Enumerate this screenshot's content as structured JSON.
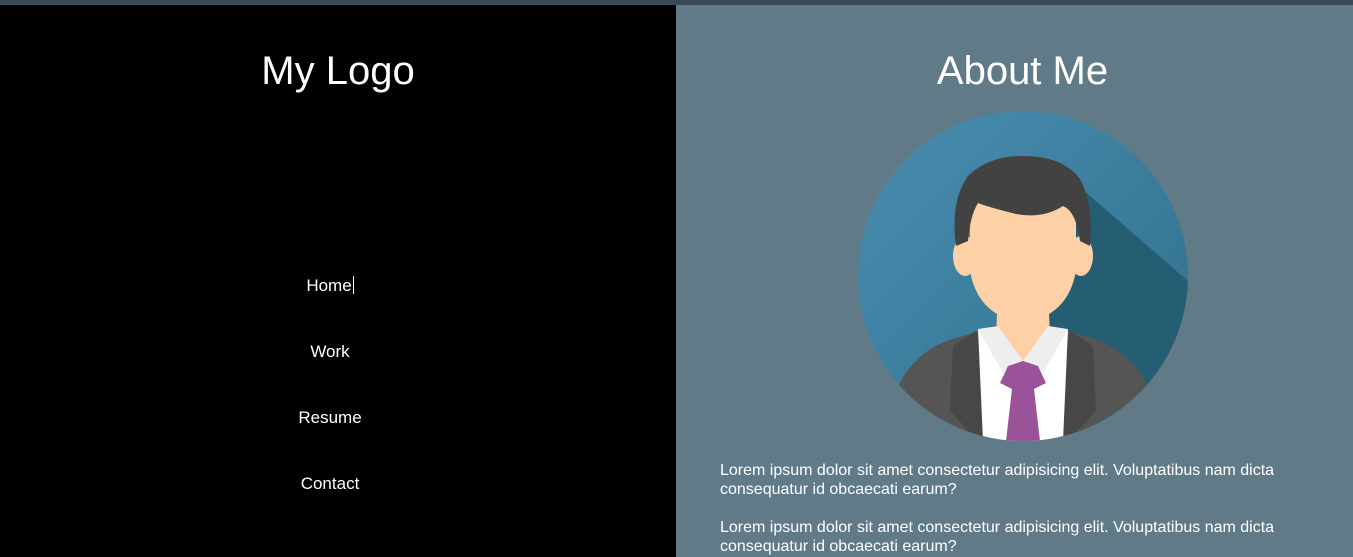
{
  "sidebar": {
    "logo": "My Logo",
    "nav": [
      {
        "label": "Home"
      },
      {
        "label": "Work"
      },
      {
        "label": "Resume"
      },
      {
        "label": "Contact"
      }
    ]
  },
  "about": {
    "title": "About Me",
    "avatar_icon": "person-avatar-icon",
    "paragraphs": [
      "Lorem ipsum dolor sit amet consectetur adipisicing elit. Voluptatibus nam dicta consequatur id obcaecati earum?",
      "Lorem ipsum dolor sit amet consectetur adipisicing elit. Voluptatibus nam dicta consequatur id obcaecati earum?"
    ]
  },
  "colors": {
    "sidebar_bg": "#000000",
    "content_bg": "#607b87",
    "avatar_circle": "#3e7d99",
    "tie": "#9a5299"
  }
}
